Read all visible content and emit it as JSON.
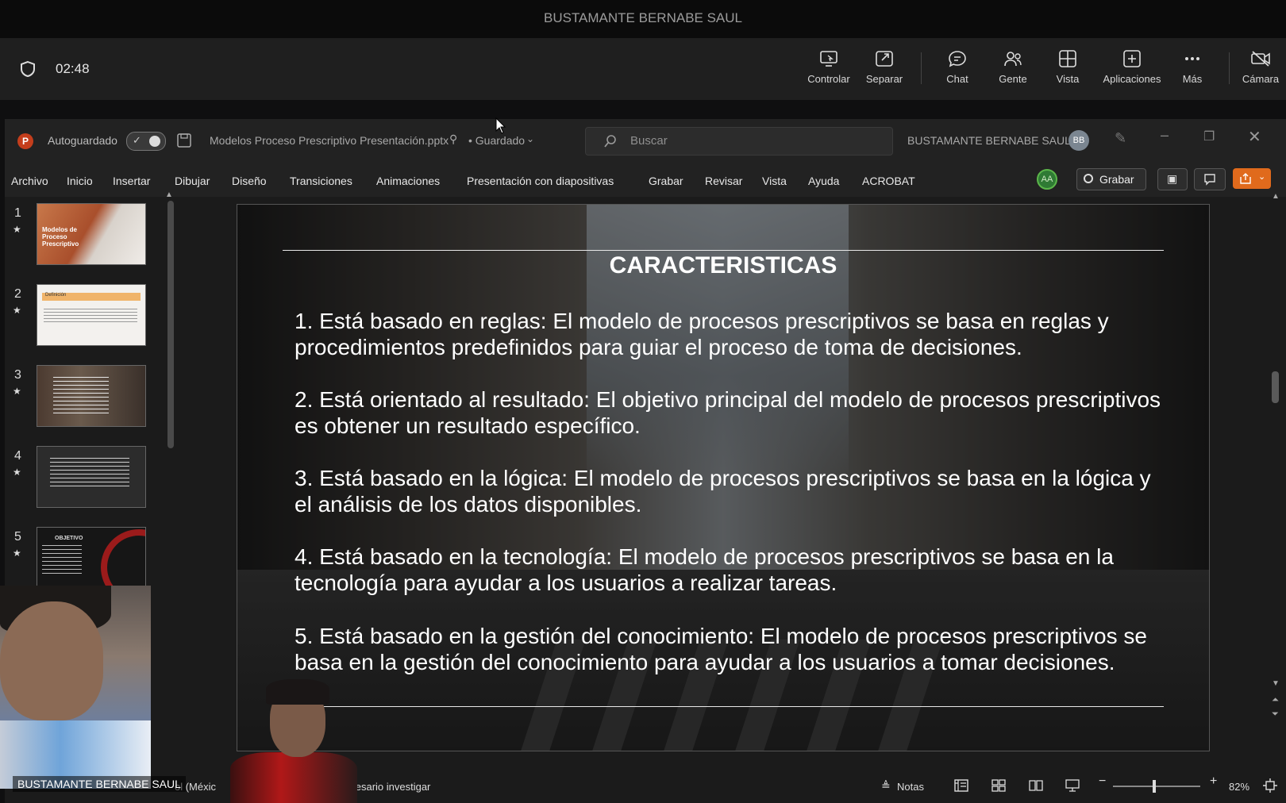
{
  "teams": {
    "window_title": "BUSTAMANTE BERNABE SAUL",
    "timer": "02:48",
    "buttons": {
      "control": "Controlar",
      "separate": "Separar",
      "chat": "Chat",
      "people": "Gente",
      "view": "Vista",
      "apps": "Aplicaciones",
      "more": "Más",
      "camera": "Cámara"
    }
  },
  "ppt": {
    "app_icon_letter": "P",
    "autosave_label": "Autoguardado",
    "file_name": "Modelos Proceso Prescriptivo Presentación.pptx",
    "save_status": "• Guardado",
    "search_placeholder": "Buscar",
    "user_name": "BUSTAMANTE BERNABE SAUL",
    "user_initials": "BB",
    "menu": [
      "Archivo",
      "Inicio",
      "Insertar",
      "Dibujar",
      "Diseño",
      "Transiciones",
      "Animaciones",
      "Presentación con diapositivas",
      "Grabar",
      "Revisar",
      "Vista",
      "Ayuda",
      "ACROBAT"
    ],
    "collab_initials": "AA",
    "record_button": "Grabar",
    "thumbnails": [
      {
        "num": "1",
        "star": "★",
        "text": "Modelos de Proceso Prescriptivo"
      },
      {
        "num": "2",
        "star": "★",
        "text": "Definición"
      },
      {
        "num": "3",
        "star": "★",
        "text": ""
      },
      {
        "num": "4",
        "star": "★",
        "text": ""
      },
      {
        "num": "5",
        "star": "★",
        "text": "OBJETIVO"
      }
    ],
    "slide": {
      "title": "CARACTERISTICAS",
      "points": [
        "1. Está basado en reglas: El modelo de procesos prescriptivos se basa en reglas y procedimientos predefinidos para guiar el proceso de toma de decisiones.",
        "2. Está orientado al resultado: El objetivo principal del modelo de procesos prescriptivos es obtener un resultado específico.",
        "3. Está basado en la lógica: El modelo de procesos prescriptivos se basa en la lógica y el análisis de los datos disponibles.",
        "4. Está basado en la tecnología: El modelo de procesos prescriptivos se basa en la tecnología para ayudar a los usuarios a realizar tareas.",
        "5. Está basado en la gestión del conocimiento: El modelo de procesos prescriptivos se basa en la gestión del conocimiento para ayudar a los usuarios a tomar decisiones."
      ]
    },
    "status": {
      "language": "ol (Méxic",
      "accessibility": "ecesario investigar",
      "notes": "Notas",
      "zoom": "82%"
    }
  },
  "video": {
    "participant_name": "BUSTAMANTE BERNABE SAUL"
  }
}
